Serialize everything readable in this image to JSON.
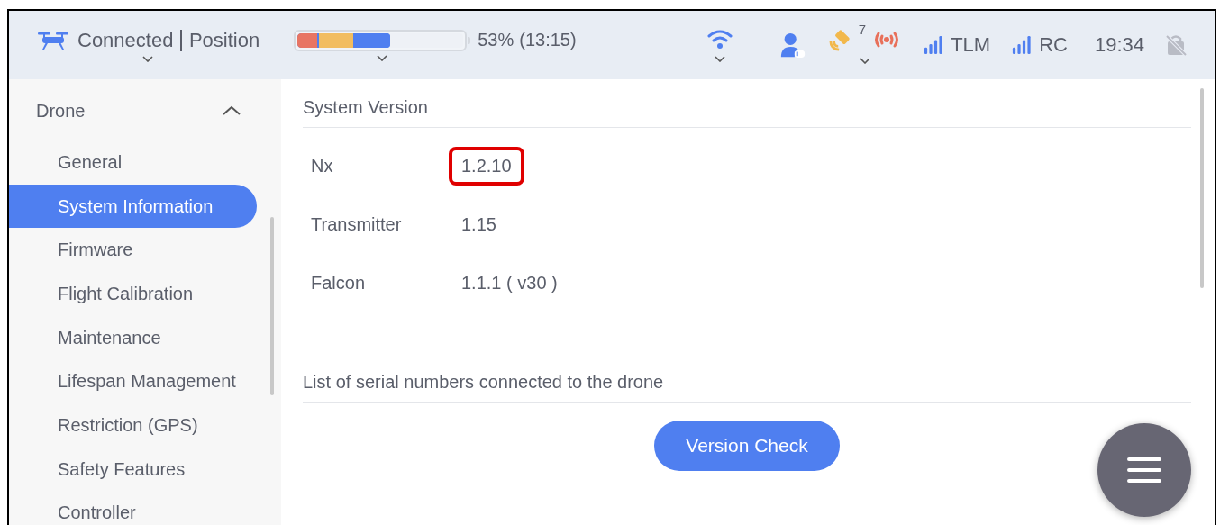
{
  "status_bar": {
    "connection": "Connected",
    "mode": "Position",
    "battery": {
      "reading": "53%",
      "time": "(13:15)"
    },
    "satellites": "7",
    "tlm": "TLM",
    "rc": "RC",
    "clock": "19:34"
  },
  "sidebar": {
    "items": [
      {
        "label": "Drone",
        "expanded": true,
        "children": [
          {
            "label": "General",
            "selected": false
          },
          {
            "label": "System Information",
            "selected": true
          },
          {
            "label": "Firmware",
            "selected": false
          },
          {
            "label": "Flight Calibration",
            "selected": false
          },
          {
            "label": "Maintenance",
            "selected": false
          },
          {
            "label": "Lifespan Management",
            "selected": false
          },
          {
            "label": "Restriction (GPS)",
            "selected": false
          },
          {
            "label": "Safety Features",
            "selected": false
          },
          {
            "label": "Controller",
            "selected": false
          }
        ]
      }
    ]
  },
  "content": {
    "section_title": "System Version",
    "rows": [
      {
        "label": "Nx",
        "value": "1.2.10",
        "highlighted": true
      },
      {
        "label": "Transmitter",
        "value": "1.15",
        "highlighted": false
      },
      {
        "label": "Falcon",
        "value": "1.1.1 ( v30 )",
        "highlighted": false
      }
    ],
    "serials_title": "List of serial numbers connected to the drone",
    "button": "Version Check"
  }
}
